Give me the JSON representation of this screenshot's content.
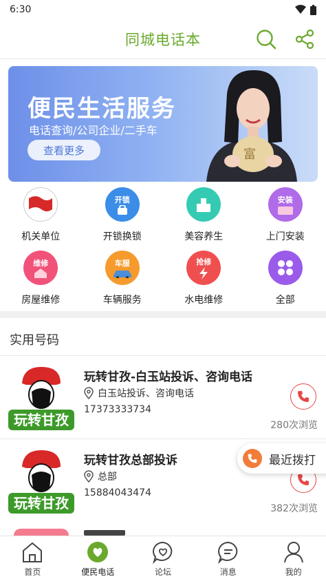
{
  "status": {
    "time": "6:30"
  },
  "header": {
    "title": "同城电话本",
    "search_icon": "search-icon",
    "share_icon": "share-icon",
    "accent": "#6aa92d"
  },
  "banner": {
    "title": "便民生活服务",
    "subtitle": "电话查询/公司企业/二手车",
    "button": "查看更多"
  },
  "categories": [
    {
      "label": "机关单位",
      "icon": "flag-icon",
      "color": "#ffffff",
      "badge": ""
    },
    {
      "label": "开锁换锁",
      "icon": "lock-icon",
      "color": "#3b8de8",
      "badge": "开锁"
    },
    {
      "label": "美容养生",
      "icon": "spa-icon",
      "color": "#35cbb3",
      "badge": ""
    },
    {
      "label": "上门安装",
      "icon": "install-icon",
      "color": "#b06be8",
      "badge": "安装"
    },
    {
      "label": "房屋维修",
      "icon": "house-repair-icon",
      "color": "#f1527a",
      "badge": "维修"
    },
    {
      "label": "车辆服务",
      "icon": "car-icon",
      "color": "#f59a2c",
      "badge": "车服"
    },
    {
      "label": "水电维修",
      "icon": "bolt-icon",
      "color": "#ef4f4f",
      "badge": "抢修"
    },
    {
      "label": "全部",
      "icon": "grid-icon",
      "color": "#9a5bea",
      "badge": ""
    }
  ],
  "section": {
    "title": "实用号码"
  },
  "listings": [
    {
      "name": "玩转甘孜-白玉站投诉、咨询电话",
      "address": "白玉站投诉、咨询电话",
      "phone": "17373333734",
      "views": "280次浏览",
      "logo_text": "玩转甘孜"
    },
    {
      "name": "玩转甘孜总部投诉",
      "address": "总部",
      "phone": "15884043474",
      "views": "382次浏览",
      "logo_text": "玩转甘孜"
    }
  ],
  "floating": {
    "label": "最近拨打"
  },
  "tabs": [
    {
      "label": "首页",
      "icon": "home-icon"
    },
    {
      "label": "便民电话",
      "icon": "heart-location-icon",
      "active": true
    },
    {
      "label": "论坛",
      "icon": "forum-heart-icon"
    },
    {
      "label": "消息",
      "icon": "message-icon"
    },
    {
      "label": "我的",
      "icon": "profile-icon"
    }
  ]
}
